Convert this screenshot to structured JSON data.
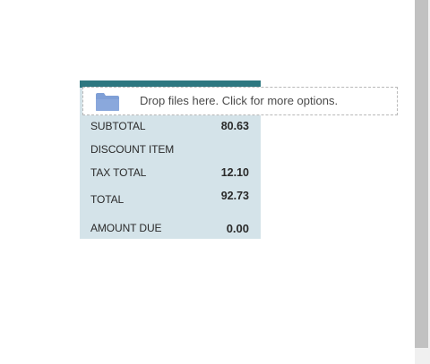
{
  "drop_zone": {
    "text": "Drop files here. Click for more options.",
    "icon": "folder-icon"
  },
  "totals": [
    {
      "label": "SUBTOTAL",
      "value": "80.63"
    },
    {
      "label": "DISCOUNT ITEM",
      "value": ""
    },
    {
      "label": "TAX TOTAL",
      "value": "12.10"
    },
    {
      "label": "TOTAL",
      "value": "92.73"
    },
    {
      "label": "AMOUNT DUE",
      "value": "0.00"
    }
  ],
  "colors": {
    "header_bar": "#2d7780",
    "panel_bg": "#d4e3e9",
    "folder_icon": "#7f9fd6"
  }
}
